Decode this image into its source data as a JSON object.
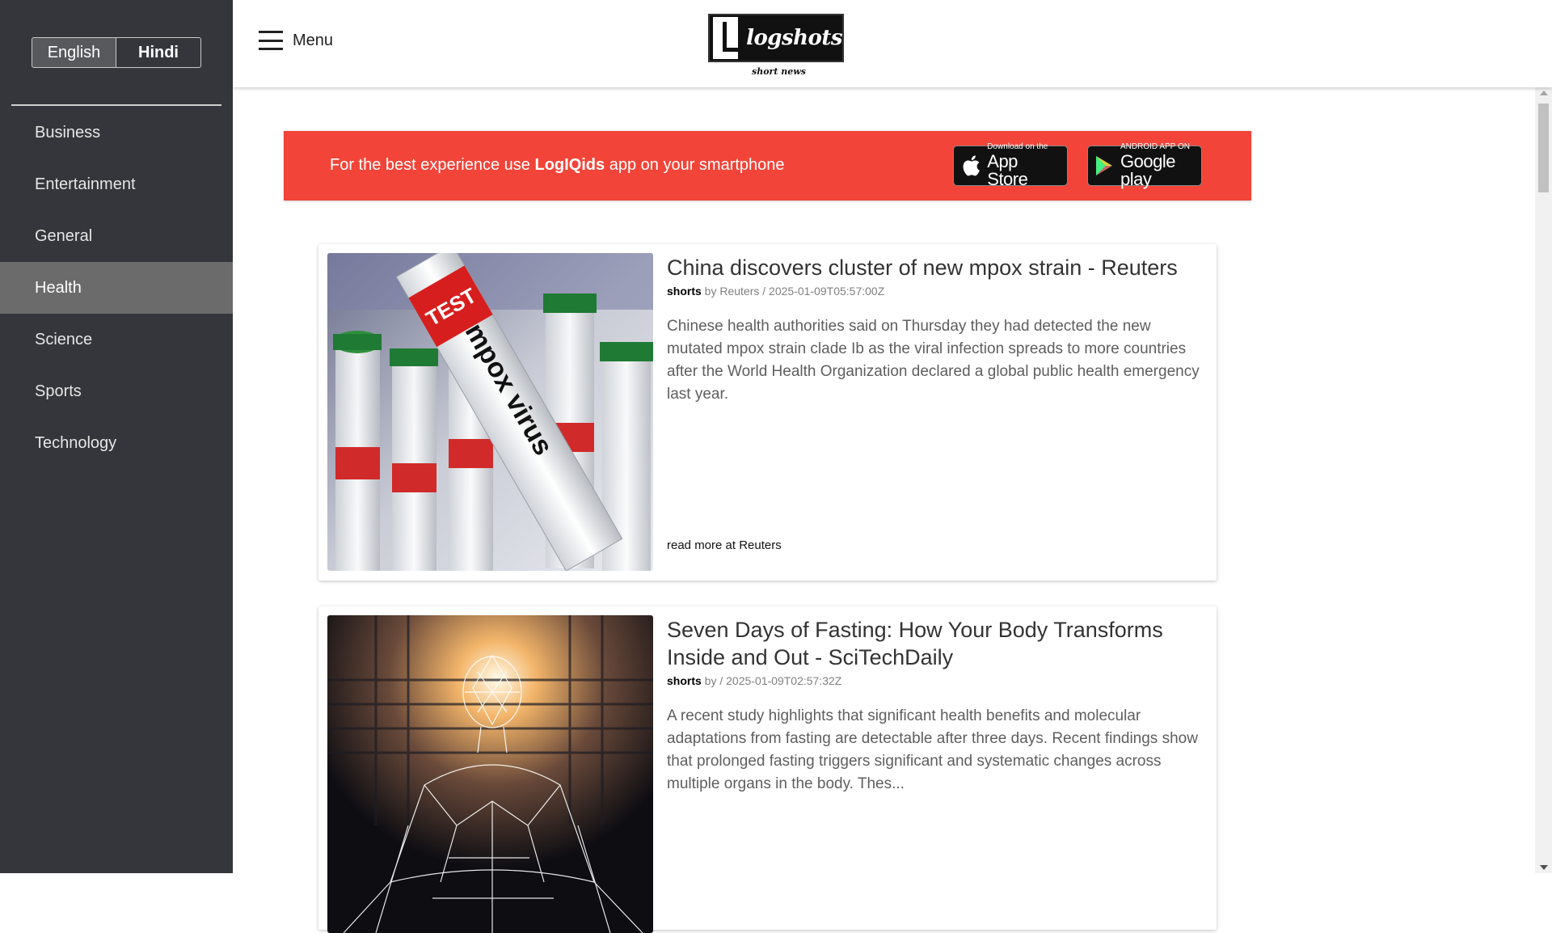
{
  "sidebar": {
    "languages": [
      {
        "label": "English",
        "active": true
      },
      {
        "label": "Hindi",
        "active": false
      }
    ],
    "items": [
      {
        "label": "Business"
      },
      {
        "label": "Entertainment"
      },
      {
        "label": "General"
      },
      {
        "label": "Health",
        "active": true
      },
      {
        "label": "Science"
      },
      {
        "label": "Sports"
      },
      {
        "label": "Technology"
      }
    ]
  },
  "header": {
    "menu_label": "Menu",
    "logo_text": "logshots",
    "logo_tagline": "short news"
  },
  "banner": {
    "text_before": "For the best experience use ",
    "app_name": "LogIQids",
    "text_after": " app on your smartphone",
    "app_store": {
      "small": "Download on the",
      "big": "App Store"
    },
    "google_play": {
      "small": "ANDROID APP ON",
      "big": "Google play"
    }
  },
  "articles": [
    {
      "title": "China discovers cluster of new mpox strain - Reuters",
      "meta_prefix": "shorts",
      "meta_rest": " by Reuters / 2025-01-09T05:57:00Z",
      "description": "Chinese health authorities said on Thursday they had detected the new mutated mpox strain clade Ib as the viral infection spreads to more countries after the World Health Organization declared a global public health emergency last year.",
      "read_more": "read more at Reuters",
      "image_label": "mpox virus",
      "image_tag": "TEST"
    },
    {
      "title": "Seven Days of Fasting: How Your Body Transforms Inside and Out - SciTechDaily",
      "meta_prefix": "shorts",
      "meta_rest": " by / 2025-01-09T02:57:32Z",
      "description": "A recent study highlights that significant health benefits and molecular adaptations from fasting are detectable after three days. Recent findings show that prolonged fasting triggers significant and systematic changes across multiple organs in the body. Thes..."
    }
  ],
  "colors": {
    "sidebar_bg": "#34363b",
    "banner_bg": "#f24438",
    "active_nav": "#6b6b6b"
  }
}
